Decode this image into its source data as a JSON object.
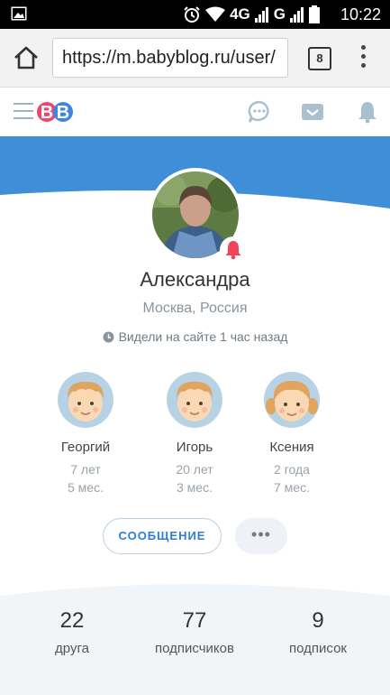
{
  "status_bar": {
    "network": "4G",
    "network2": "G",
    "time": "10:22"
  },
  "browser": {
    "url": "https://m.babyblog.ru/user/",
    "tab_count": "8"
  },
  "profile": {
    "name": "Александра",
    "city": "Москва, Россия",
    "last_seen": "Видели на сайте 1 час назад"
  },
  "children": [
    {
      "name": "Георгий",
      "age_years": "7 лет",
      "age_months": "5 мес."
    },
    {
      "name": "Игорь",
      "age_years": "20 лет",
      "age_months": "3 мес."
    },
    {
      "name": "Ксения",
      "age_years": "2 года",
      "age_months": "7 мес."
    }
  ],
  "actions": {
    "message_label": "СООБЩЕНИЕ",
    "more_label": "•••"
  },
  "stats": [
    {
      "value": "22",
      "label": "друга"
    },
    {
      "value": "77",
      "label": "подписчиков"
    },
    {
      "value": "9",
      "label": "подписок"
    }
  ],
  "colors": {
    "brand_blue": "#3f8fd8",
    "accent_red": "#f0445a",
    "link_blue": "#2e7dd6"
  },
  "icons": [
    "gallery-icon",
    "alarm-icon",
    "wifi-icon",
    "signal-icon",
    "battery-icon",
    "home-icon",
    "menu-dots-icon",
    "hamburger-icon",
    "chat-icon",
    "mail-icon",
    "bell-icon",
    "clock-icon"
  ]
}
